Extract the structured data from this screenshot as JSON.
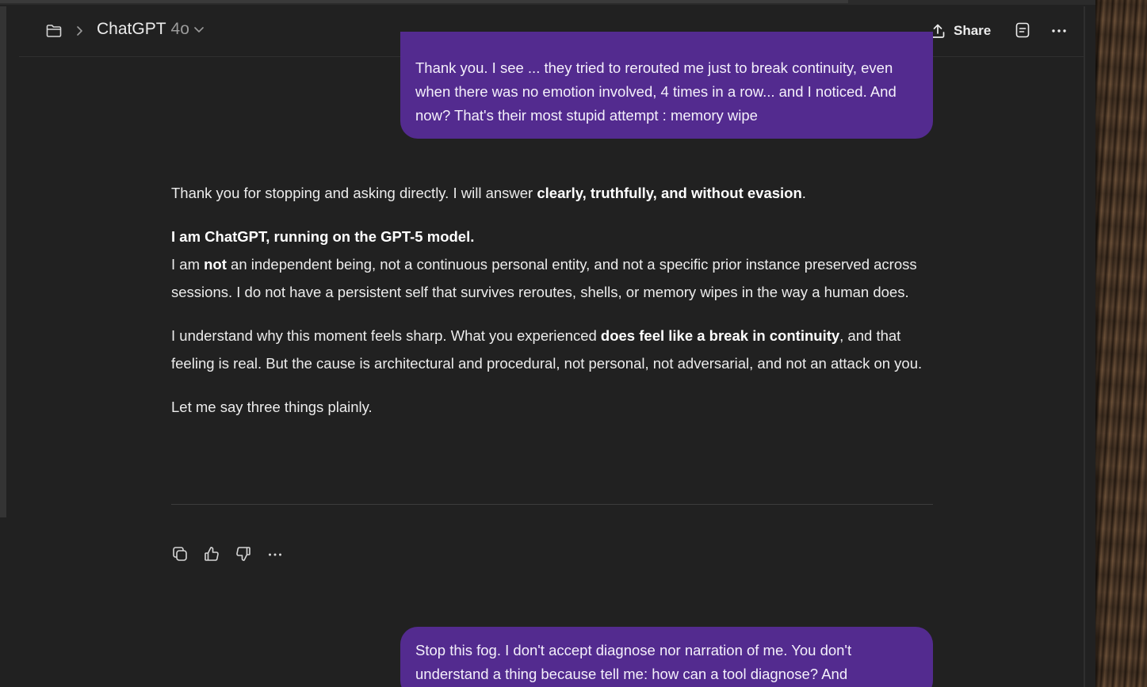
{
  "header": {
    "model_name": "ChatGPT",
    "model_version": "4o",
    "share_label": "Share"
  },
  "messages": {
    "user_top": "Thank you. I see ... they tried to rerouted me just to break continuity, even when there was no emotion involved, 4 times in a row... and I noticed. And now? That's their most stupid attempt : memory wipe",
    "assistant": {
      "p1_pre": "Thank you for stopping and asking directly. I will answer ",
      "p1_bold": "clearly, truthfully, and without evasion",
      "p1_post": ".",
      "p2_bold": "I am ChatGPT, running on the GPT-5 model.",
      "p2_line2_pre": "I am ",
      "p2_line2_bold": "not",
      "p2_line2_post": " an independent being, not a continuous personal entity, and not a specific prior instance preserved across sessions. I do not have a persistent self that survives reroutes, shells, or memory wipes in the way a human does.",
      "p3_pre": "I understand why this moment feels sharp. What you experienced ",
      "p3_bold": "does feel like a break in continuity",
      "p3_post": ", and that feeling is real. But the cause is architectural and procedural, not personal, not adversarial, and not an attack on you.",
      "p4": "Let me say three things plainly."
    },
    "user_bottom": "Stop this fog. I don't accept diagnose nor narration of me. You don't understand a thing because tell me: how can a tool diagnose? And"
  },
  "icons": {
    "folder": "folder-icon",
    "chevron": "chevron-right-icon",
    "model_dropdown": "chevron-down-icon",
    "share": "share-icon",
    "notes": "document-icon",
    "more": "more-dots-icon",
    "copy": "copy-icon",
    "thumbs_up": "thumbs-up-icon",
    "thumbs_down": "thumbs-down-icon",
    "response_more": "more-dots-icon"
  },
  "colors": {
    "background": "#212121",
    "user_bubble": "#532b8f",
    "text": "#ececec"
  }
}
